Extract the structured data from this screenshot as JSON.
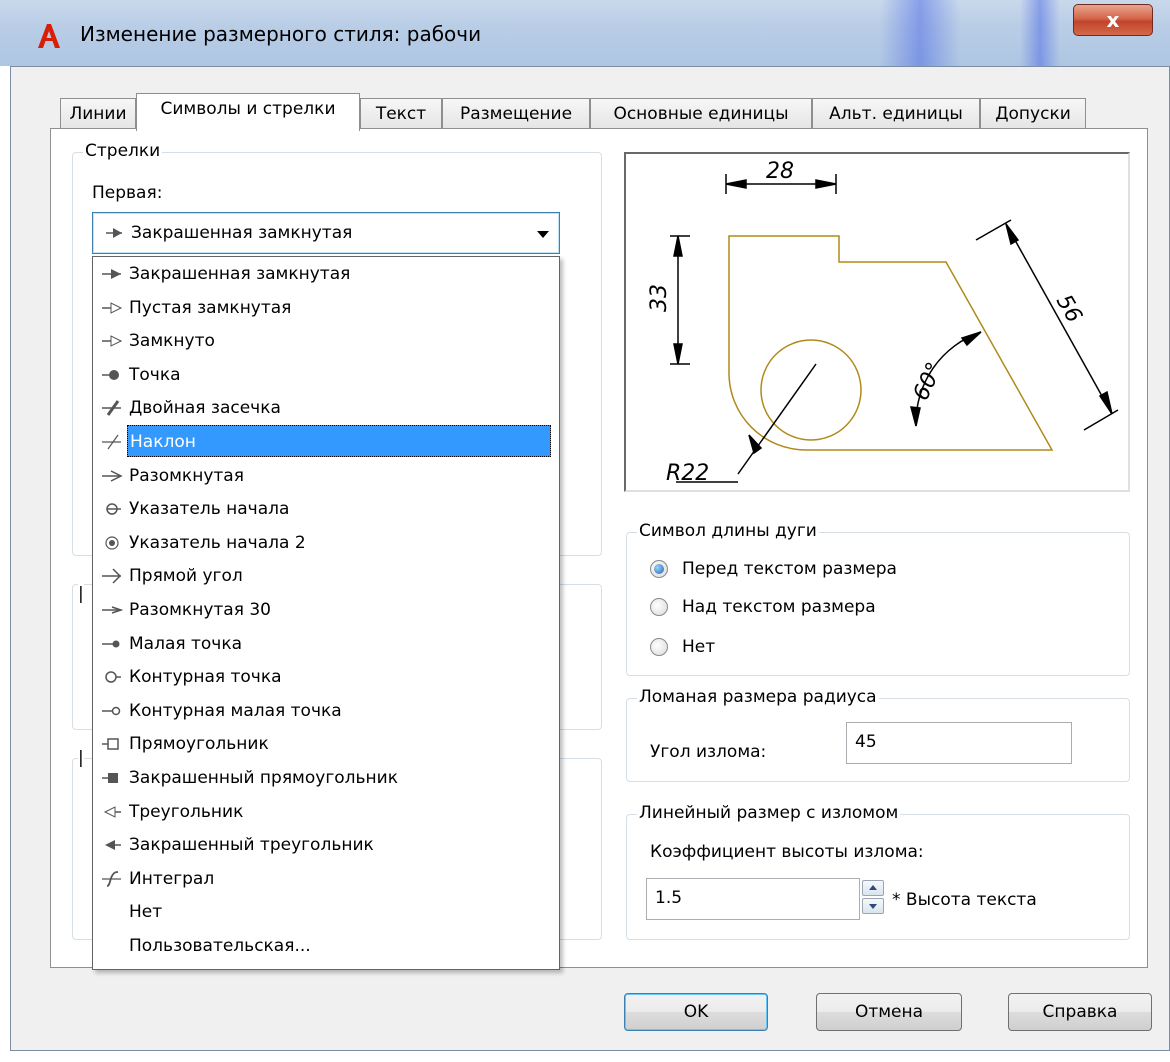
{
  "window": {
    "title": "Изменение размерного стиля: рабочи",
    "close_label": "x"
  },
  "tabs": [
    {
      "label": "Линии"
    },
    {
      "label": "Символы и стрелки"
    },
    {
      "label": "Текст"
    },
    {
      "label": "Размещение"
    },
    {
      "label": "Основные единицы"
    },
    {
      "label": "Альт. единицы"
    },
    {
      "label": "Допуски"
    }
  ],
  "arrows": {
    "group_label": "Стрелки",
    "first_label": "Первая:",
    "first_value": "Закрашенная замкнутая",
    "dropdown_items": [
      {
        "label": "Закрашенная замкнутая",
        "icon": "filled-closed-arrow-icon"
      },
      {
        "label": "Пустая замкнутая",
        "icon": "closed-blank-arrow-icon"
      },
      {
        "label": "Замкнуто",
        "icon": "closed-arrow-icon"
      },
      {
        "label": "Точка",
        "icon": "dot-icon"
      },
      {
        "label": "Двойная засечка",
        "icon": "architectural-tick-icon"
      },
      {
        "label": "Наклон",
        "icon": "oblique-icon"
      },
      {
        "label": "Разомкнутая",
        "icon": "open-arrow-icon"
      },
      {
        "label": "Указатель начала",
        "icon": "origin-indicator-icon"
      },
      {
        "label": "Указатель начала 2",
        "icon": "origin-indicator-2-icon"
      },
      {
        "label": "Прямой угол",
        "icon": "right-angle-icon"
      },
      {
        "label": "Разомкнутая 30",
        "icon": "open-30-icon"
      },
      {
        "label": "Малая точка",
        "icon": "dot-small-icon"
      },
      {
        "label": "Контурная точка",
        "icon": "dot-blank-icon"
      },
      {
        "label": "Контурная малая точка",
        "icon": "dot-small-blank-icon"
      },
      {
        "label": "Прямоугольник",
        "icon": "box-icon"
      },
      {
        "label": "Закрашенный прямоугольник",
        "icon": "box-filled-icon"
      },
      {
        "label": "Треугольник",
        "icon": "datum-triangle-icon"
      },
      {
        "label": "Закрашенный треугольник",
        "icon": "datum-triangle-filled-icon"
      },
      {
        "label": "Интеграл",
        "icon": "integral-icon"
      },
      {
        "label": "Нет",
        "icon": ""
      },
      {
        "label": "Пользовательская...",
        "icon": ""
      }
    ],
    "selected_index": 5
  },
  "preview": {
    "dim_top": "28",
    "dim_left": "33",
    "dim_right": "56",
    "dim_angle": "60°",
    "dim_radius": "R22"
  },
  "arc_length": {
    "group_label": "Символ длины дуги",
    "options": [
      "Перед текстом размера",
      "Над текстом размера",
      "Нет"
    ],
    "selected_index": 0
  },
  "radius_jog": {
    "group_label": "Ломаная размера радиуса",
    "angle_label": "Угол излома:",
    "angle_value": "45"
  },
  "linear_jog": {
    "group_label": "Линейный размер с изломом",
    "factor_label": "Коэффициент высоты излома:",
    "factor_value": "1.5",
    "suffix": "* Высота текста"
  },
  "buttons": {
    "ok": "OK",
    "cancel": "Отмена",
    "help": "Справка"
  },
  "colors": {
    "selection": "#3399ff",
    "preview_geometry": "#b08a1c",
    "close_button": "#c2442a"
  }
}
